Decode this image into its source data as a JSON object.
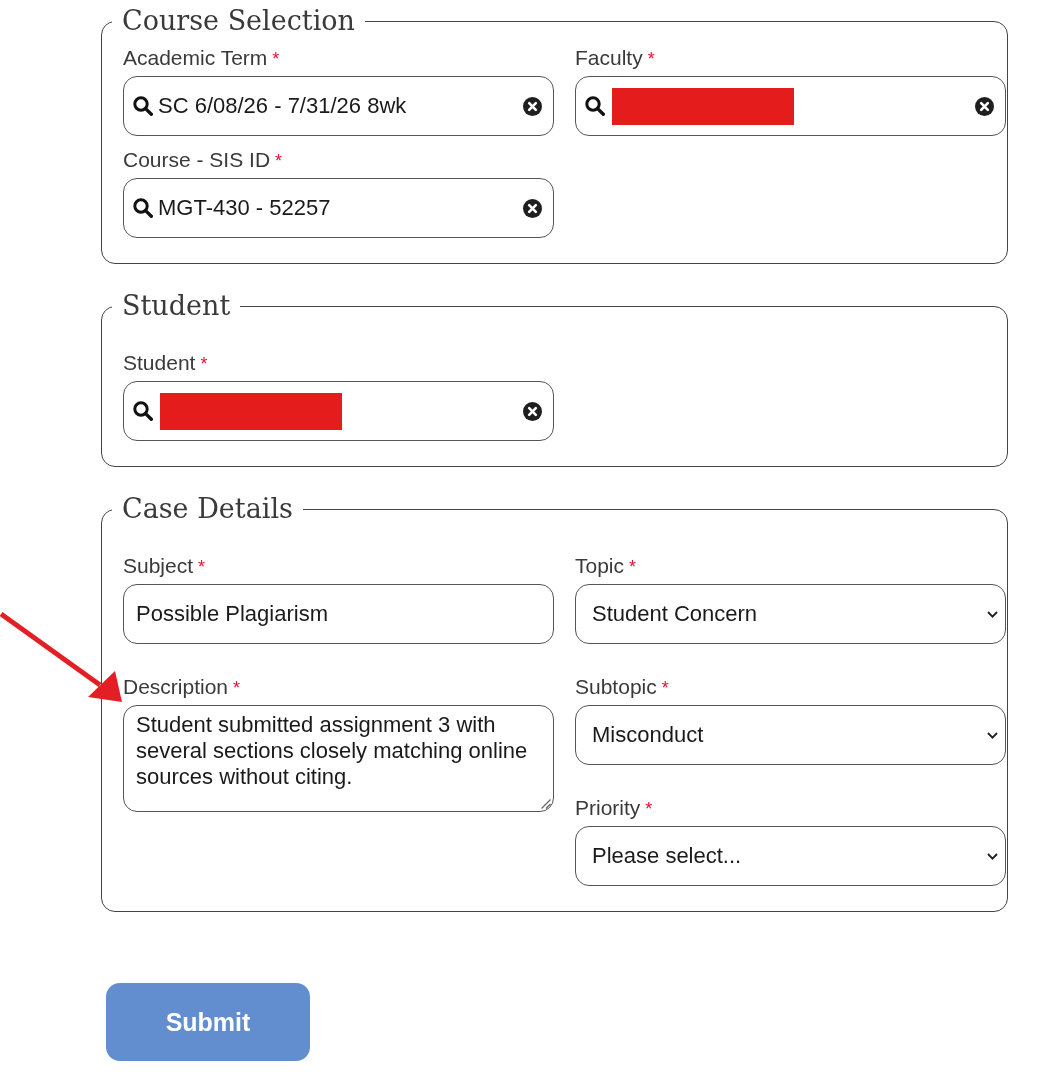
{
  "sections": [
    {
      "title": "Course Selection",
      "columns": [
        [
          {
            "kind": "search",
            "label": "Academic Term",
            "required_mark": "*",
            "value": "SC 6/08/26 - 7/31/26 8wk",
            "redacted": false,
            "pointed_at": false
          },
          {
            "kind": "search",
            "label": "Course - SIS ID",
            "required_mark": "*",
            "value": "MGT-430 - 52257",
            "redacted": false,
            "pointed_at": false
          }
        ],
        [
          {
            "kind": "search",
            "label": "Faculty",
            "required_mark": "*",
            "redacted": true,
            "pointed_at": false
          }
        ]
      ]
    },
    {
      "title": "Student",
      "columns": [
        [
          {
            "kind": "search",
            "label": "Student",
            "required_mark": "*",
            "redacted": true,
            "pointed_at": false
          }
        ]
      ]
    },
    {
      "title": "Case Details",
      "columns": [
        [
          {
            "kind": "text",
            "label": "Subject",
            "required_mark": "*",
            "value": "Possible Plagiarism",
            "redacted": false,
            "pointed_at": false
          },
          {
            "kind": "textarea",
            "label": "Description",
            "required_mark": "*",
            "value": "Student submitted assignment 3 with several sections closely matching online sources without citing.",
            "redacted": false,
            "pointed_at": true
          }
        ],
        [
          {
            "kind": "select",
            "label": "Topic",
            "required_mark": "*",
            "value": "Student Concern",
            "redacted": false,
            "pointed_at": false
          },
          {
            "kind": "select",
            "label": "Subtopic",
            "required_mark": "*",
            "value": "Misconduct",
            "redacted": false,
            "pointed_at": false
          },
          {
            "kind": "select",
            "label": "Priority",
            "required_mark": "*",
            "value": "Please select...",
            "redacted": false,
            "pointed_at": false
          }
        ]
      ]
    }
  ],
  "submit_button": {
    "label": "Submit"
  }
}
